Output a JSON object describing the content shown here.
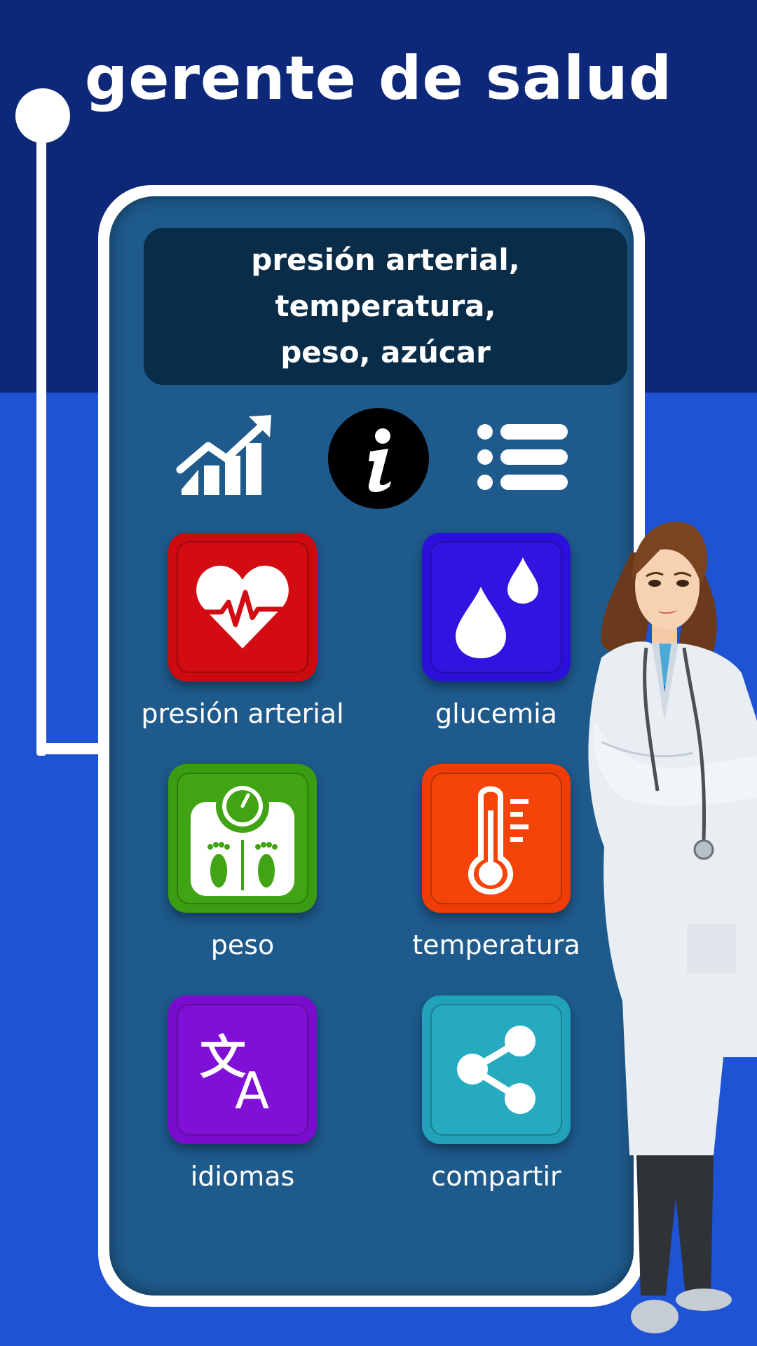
{
  "headline": "gerente de salud",
  "banner": {
    "line1": "presión arterial, temperatura,",
    "line2": "peso, azúcar"
  },
  "toolbar": {
    "chart_icon": "chart-trend-icon",
    "info_icon": "info-icon",
    "list_icon": "list-icon"
  },
  "tiles": [
    {
      "label": "presión arterial",
      "icon": "heart-pulse-icon",
      "color": "#cc0a10"
    },
    {
      "label": "glucemia",
      "icon": "drops-icon",
      "color": "#2a10d8"
    },
    {
      "label": "peso",
      "icon": "scale-icon",
      "color": "#3a9c10"
    },
    {
      "label": "temperatura",
      "icon": "thermometer-icon",
      "color": "#f03c06"
    },
    {
      "label": "idiomas",
      "icon": "translate-icon",
      "color": "#7a0cce"
    },
    {
      "label": "compartir",
      "icon": "share-icon",
      "color": "#22a2b8"
    }
  ],
  "colors": {
    "top_band": "#0d2878",
    "background": "#1e53d4",
    "screen": "#1e5a8c",
    "banner": "#092c48"
  }
}
